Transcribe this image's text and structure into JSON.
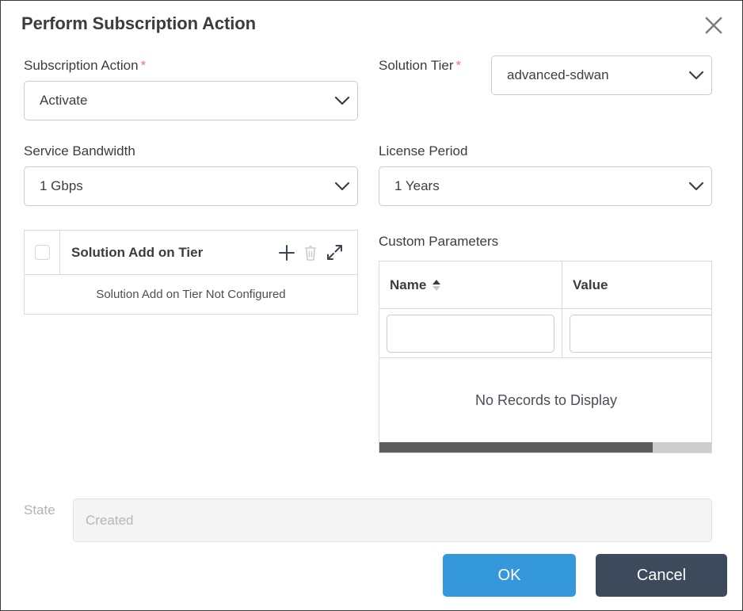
{
  "dialog": {
    "title": "Perform Subscription Action",
    "close_icon": "close-icon"
  },
  "form": {
    "subscription_action": {
      "label": "Subscription Action",
      "required_marker": "*",
      "value": "Activate",
      "chevron_icon": "chevron-down-icon"
    },
    "solution_tier": {
      "label": "Solution Tier",
      "required_marker": "*",
      "value": "advanced-sdwan",
      "chevron_icon": "chevron-down-icon"
    },
    "service_bandwidth": {
      "label": "Service Bandwidth",
      "value": "1 Gbps",
      "chevron_icon": "chevron-down-icon"
    },
    "license_period": {
      "label": "License Period",
      "value": "1 Years",
      "chevron_icon": "chevron-down-icon"
    },
    "state": {
      "label": "State",
      "placeholder": "Created",
      "value": ""
    }
  },
  "addon_table": {
    "title": "Solution Add on Tier",
    "empty_message": "Solution Add on Tier Not Configured",
    "select_all_checkbox": "checkbox",
    "actions": {
      "add_icon": "plus-icon",
      "delete_icon": "trash-icon",
      "expand_icon": "expand-icon"
    }
  },
  "custom_parameters": {
    "label": "Custom Parameters",
    "columns": [
      {
        "key": "name",
        "header": "Name",
        "sorted": "asc"
      },
      {
        "key": "value",
        "header": "Value",
        "sorted": "none"
      }
    ],
    "filters": {
      "name": "",
      "value": ""
    },
    "rows": [],
    "empty_message": "No Records to Display",
    "scroll": {
      "thumb_percent": 82
    }
  },
  "footer": {
    "ok_label": "OK",
    "cancel_label": "Cancel"
  },
  "colors": {
    "primary": "#3498db",
    "secondary": "#3d4a5c",
    "required": "#f2707a",
    "text": "#3c3c3c",
    "border": "#c8ccd0",
    "disabled_bg": "#f4f4f5",
    "scroll_thumb": "#5d5d5d"
  }
}
